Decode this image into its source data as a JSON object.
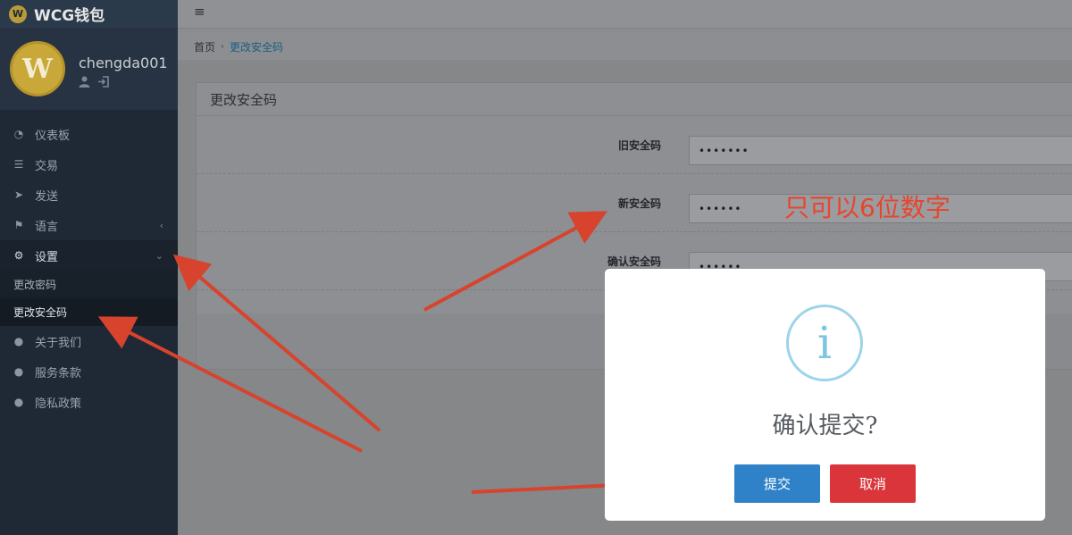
{
  "app": {
    "logo_glyph": "W",
    "title": "WCG钱包"
  },
  "user": {
    "avatar_glyph": "W",
    "name": "chengda001",
    "profile_icon": "user-icon",
    "logout_icon": "sign-out-icon"
  },
  "sidebar": {
    "items": [
      {
        "label": "仪表板",
        "icon": "dashboard-icon"
      },
      {
        "label": "交易",
        "icon": "list-icon"
      },
      {
        "label": "发送",
        "icon": "send-icon"
      },
      {
        "label": "语言",
        "icon": "language-icon",
        "caret": "‹"
      },
      {
        "label": "设置",
        "icon": "gear-icon",
        "caret": "⌄"
      },
      {
        "label": "关于我们",
        "icon": "info-icon"
      },
      {
        "label": "服务条款",
        "icon": "info-icon"
      },
      {
        "label": "隐私政策",
        "icon": "info-icon"
      }
    ],
    "submenu": [
      {
        "label": "更改密码"
      },
      {
        "label": "更改安全码"
      }
    ]
  },
  "topbar": {
    "menu_icon": "≡"
  },
  "breadcrumb": {
    "home": "首页",
    "separator": "›",
    "current": "更改安全码"
  },
  "card": {
    "title": "更改安全码",
    "fields": [
      {
        "label": "旧安全码",
        "value": "•••••••"
      },
      {
        "label": "新安全码",
        "value": "••••••"
      },
      {
        "label": "确认安全码",
        "value": "••••••"
      }
    ]
  },
  "annotation": {
    "text": "只可以6位数字",
    "color": "#e8452e"
  },
  "modal": {
    "icon": "i",
    "title": "确认提交?",
    "confirm_label": "提交",
    "cancel_label": "取消",
    "confirm_color": "#2f82c8",
    "cancel_color": "#d9353a"
  }
}
